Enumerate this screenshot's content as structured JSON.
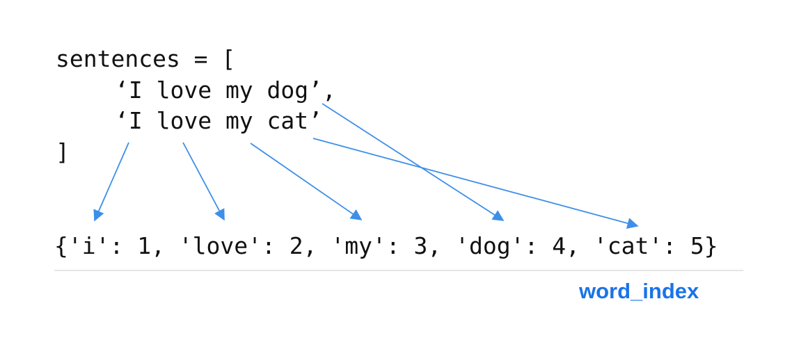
{
  "code": {
    "line1": "sentences = [",
    "line2": "‘I love my dog’,",
    "line3": "‘I love my cat’",
    "line4": "]"
  },
  "word_index_text": "{'i': 1, 'love': 2, 'my': 3, 'dog': 4, 'cat': 5}",
  "caption": "word_index",
  "colors": {
    "arrow": "#3d8fe8",
    "caption": "#1a73e8"
  },
  "arrows": [
    {
      "from": "I",
      "to": "'i': 1"
    },
    {
      "from": "love",
      "to": "'love': 2"
    },
    {
      "from": "my",
      "to": "'my': 3"
    },
    {
      "from": "dog",
      "to": "'dog': 4"
    },
    {
      "from": "cat",
      "to": "'cat': 5"
    }
  ]
}
